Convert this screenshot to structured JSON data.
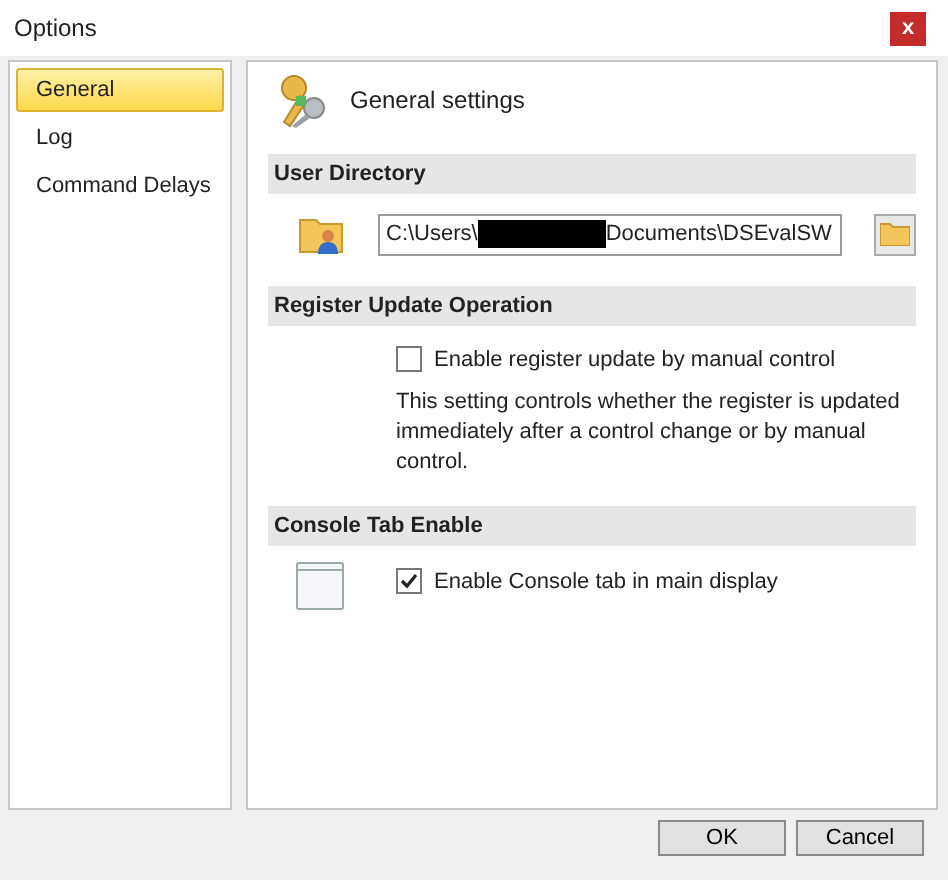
{
  "window": {
    "title": "Options",
    "close": "x"
  },
  "sidebar": {
    "items": [
      {
        "label": "General",
        "selected": true
      },
      {
        "label": "Log",
        "selected": false
      },
      {
        "label": "Command Delays",
        "selected": false
      }
    ]
  },
  "page_title": "General settings",
  "sections": [
    {
      "heading": "User Directory",
      "kind": "path",
      "path_start": "C:\\Users\\",
      "path_end": "Documents\\DSEvalSW",
      "redacted": true
    },
    {
      "heading": "Register Update Operation",
      "kind": "checkbox",
      "label": "Enable register update by manual control",
      "checked": false,
      "description": "This setting controls whether the register is updated immediately after a control change or by manual control."
    },
    {
      "heading": "Console Tab Enable",
      "kind": "checkbox_icon",
      "label": "Enable Console tab in main display",
      "checked": true
    }
  ],
  "buttons": [
    "OK",
    "Cancel"
  ]
}
